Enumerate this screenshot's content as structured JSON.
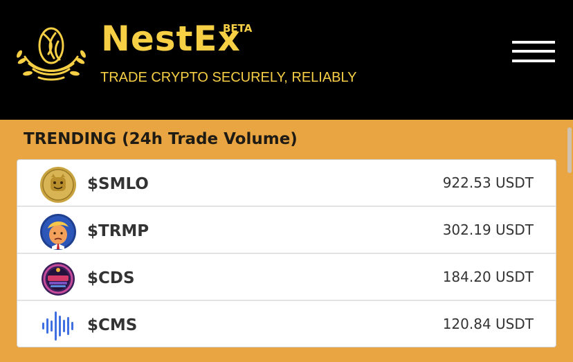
{
  "header": {
    "brand": "NestEx",
    "badge": "BETA",
    "tagline": "TRADE CRYPTO SECURELY, RELIABLY"
  },
  "trending": {
    "title": "TRENDING (24h Trade Volume)",
    "items": [
      {
        "ticker": "$SMLO",
        "volume": "922.53 USDT",
        "icon": "smlo-coin-icon"
      },
      {
        "ticker": "$TRMP",
        "volume": "302.19 USDT",
        "icon": "trmp-coin-icon"
      },
      {
        "ticker": "$CDS",
        "volume": "184.20 USDT",
        "icon": "cds-coin-icon"
      },
      {
        "ticker": "$CMS",
        "volume": "120.84 USDT",
        "icon": "cms-soundwave-icon"
      }
    ]
  },
  "colors": {
    "header_bg": "#000000",
    "brand_gold": "#f7cf45",
    "page_bg": "#e8a542",
    "card_bg": "#ffffff",
    "cms_blue": "#3f6fe0"
  }
}
